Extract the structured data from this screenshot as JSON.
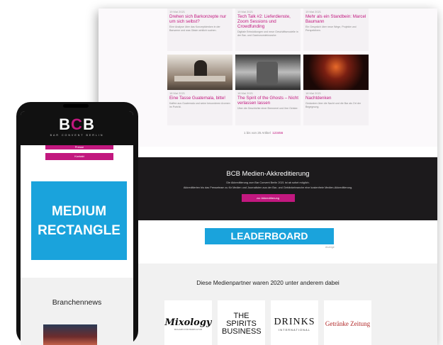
{
  "desktop": {
    "articles": [
      {
        "date": "19 Mai 2021",
        "title": "Drehen sich Barkonzepte nur um sich selbst?",
        "excerpt": "Eine Analyse über das Konzeptdenken in der Barszene und was Gäste wirklich suchen."
      },
      {
        "date": "19 Mai 2021",
        "title": "Tech Talk #2: Lieferdienste, Zoom Sessions und Crowdfunding",
        "excerpt": "Digitale Entwicklungen und neue Geschäftsmodelle in der Bar- und Gastronomiebranche."
      },
      {
        "date": "19 Mai 2021",
        "title": "Mehr als ein Standbein: Marcel Baumann",
        "excerpt": "Ein Gespräch über neue Wege, Projekte und Perspektiven."
      },
      {
        "date": "18 Mai 2021",
        "title": "Eine Tasse Guatemala, bitte!",
        "excerpt": "Kaffee aus Guatemala und seine besonderen Aromen im Porträt."
      },
      {
        "date": "18 Mai 2021",
        "title": "The Spirit of the Ghosts – Nicht verlassen lassen",
        "excerpt": "Über die Geschichte einer Brennerei und ihre Geister."
      },
      {
        "date": "18 Mai 2021",
        "title": "Nachtdenken",
        "excerpt": "Gedanken über die Nacht und die Bar als Ort der Begegnung."
      }
    ],
    "pager": {
      "text": "1 bis von 25 Artikel",
      "next": "123456"
    },
    "accred": {
      "title": "BCB Medien-Akkreditierung",
      "line1": "Die Akkreditierung zum Bar Convent Berlin 2021 ist ab sofort möglich.",
      "line2": "Akkreditierten bis das Presseteam zu für Medien und Journalisten aus der Bar- und Getränkebranche eine kostenfreie Medien-Akkreditierung.",
      "button": "zur Akkreditierung"
    },
    "leaderboard": "LEADERBOARD",
    "leaderboard_note": "Anzeige",
    "partners_title": "Diese Medienpartner waren 2020 unter anderem dabei",
    "partners": [
      {
        "name": "Mixology",
        "sub": "MAGAZIN FÜR BARKULTUR"
      },
      {
        "name": "THE SPIRITS BUSINESS",
        "sub": ""
      },
      {
        "name": "DRINKS",
        "sub": "INTERNATIONAL"
      },
      {
        "name": "Getränke Zeitung",
        "sub": ""
      }
    ]
  },
  "phone": {
    "brand_left": "B",
    "brand_mid": "C",
    "brand_right": "B",
    "brand_sub": "BAR CONVENT BERLIN",
    "menu_button_1": "Presse",
    "menu_button_2": "Kontakt",
    "ad_line1": "MEDIUM",
    "ad_line2": "RECTANGLE",
    "news_title": "Branchennews"
  },
  "colors": {
    "accent": "#c2187f",
    "ad_blue": "#1aa3dc",
    "dark": "#1c1a1c"
  }
}
